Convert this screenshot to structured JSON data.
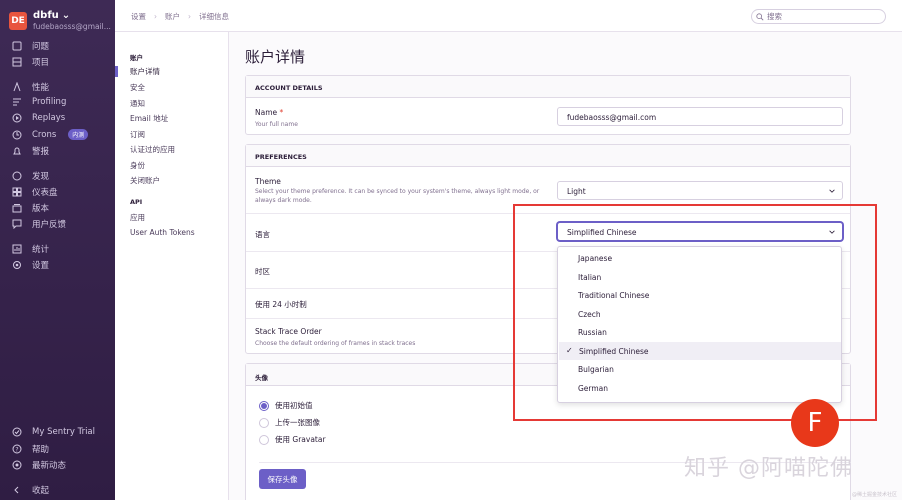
{
  "org": {
    "initials": "DE",
    "name": "dbfu",
    "email": "fudebaosss@gmail..."
  },
  "sidebar": {
    "items": [
      {
        "label": "问题",
        "icon": "issues-icon"
      },
      {
        "label": "项目",
        "icon": "projects-icon"
      },
      {
        "label": "性能",
        "icon": "performance-icon"
      },
      {
        "label": "Profiling",
        "icon": "profiling-icon"
      },
      {
        "label": "Replays",
        "icon": "replays-icon"
      },
      {
        "label": "Crons",
        "icon": "crons-icon",
        "badge": "内测"
      },
      {
        "label": "警报",
        "icon": "alerts-icon"
      },
      {
        "label": "发现",
        "icon": "discover-icon"
      },
      {
        "label": "仪表盘",
        "icon": "dashboards-icon"
      },
      {
        "label": "版本",
        "icon": "releases-icon"
      },
      {
        "label": "用户反馈",
        "icon": "feedback-icon"
      },
      {
        "label": "统计",
        "icon": "stats-icon"
      },
      {
        "label": "设置",
        "icon": "settings-icon"
      }
    ],
    "footer": [
      {
        "label": "My Sentry Trial",
        "icon": "trial-icon"
      },
      {
        "label": "帮助",
        "icon": "help-icon"
      },
      {
        "label": "最新动态",
        "icon": "broadcast-icon"
      },
      {
        "label": "收起",
        "icon": "collapse-icon"
      }
    ]
  },
  "breadcrumb": [
    "设置",
    "账户",
    "详细信息"
  ],
  "search": {
    "placeholder": "搜索"
  },
  "settings_nav": {
    "account_heading": "账户",
    "account_items": [
      "账户详情",
      "安全",
      "通知",
      "Email 地址",
      "订阅",
      "认证过的应用",
      "身份",
      "关闭账户"
    ],
    "api_heading": "API",
    "api_items": [
      "应用",
      "User Auth Tokens"
    ]
  },
  "page": {
    "title": "账户详情",
    "account_details": {
      "heading": "ACCOUNT DETAILS",
      "name_label": "Name",
      "name_required": "*",
      "name_help": "Your full name",
      "name_value": "fudebaosss@gmail.com"
    },
    "preferences": {
      "heading": "PREFERENCES",
      "theme_label": "Theme",
      "theme_help": "Select your theme preference. It can be synced to your system's theme, always light mode, or always dark mode.",
      "theme_value": "Light",
      "language_label": "语言",
      "language_value": "Simplified Chinese",
      "timezone_label": "时区",
      "clock24_label": "使用 24 小时制",
      "stacktrace_label": "Stack Trace Order",
      "stacktrace_help": "Choose the default ordering of frames in stack traces"
    },
    "language_options": [
      "Japanese",
      "Italian",
      "Traditional Chinese",
      "Czech",
      "Russian",
      "Simplified Chinese",
      "Bulgarian",
      "German"
    ],
    "language_selected_index": 5,
    "avatar": {
      "heading": "头像",
      "options": [
        "使用初始值",
        "上传一张图像",
        "使用 Gravatar"
      ],
      "selected_index": 0,
      "save_label": "保存头像"
    }
  },
  "overlay": {
    "user_initial": "F",
    "watermark": "知乎 @阿喵陀佛",
    "watermark_small": "@稀土掘金技术社区"
  },
  "colors": {
    "accent": "#6c5fc7",
    "highlight_box": "#e53935",
    "sidebar_bg": "#3e2a55"
  }
}
